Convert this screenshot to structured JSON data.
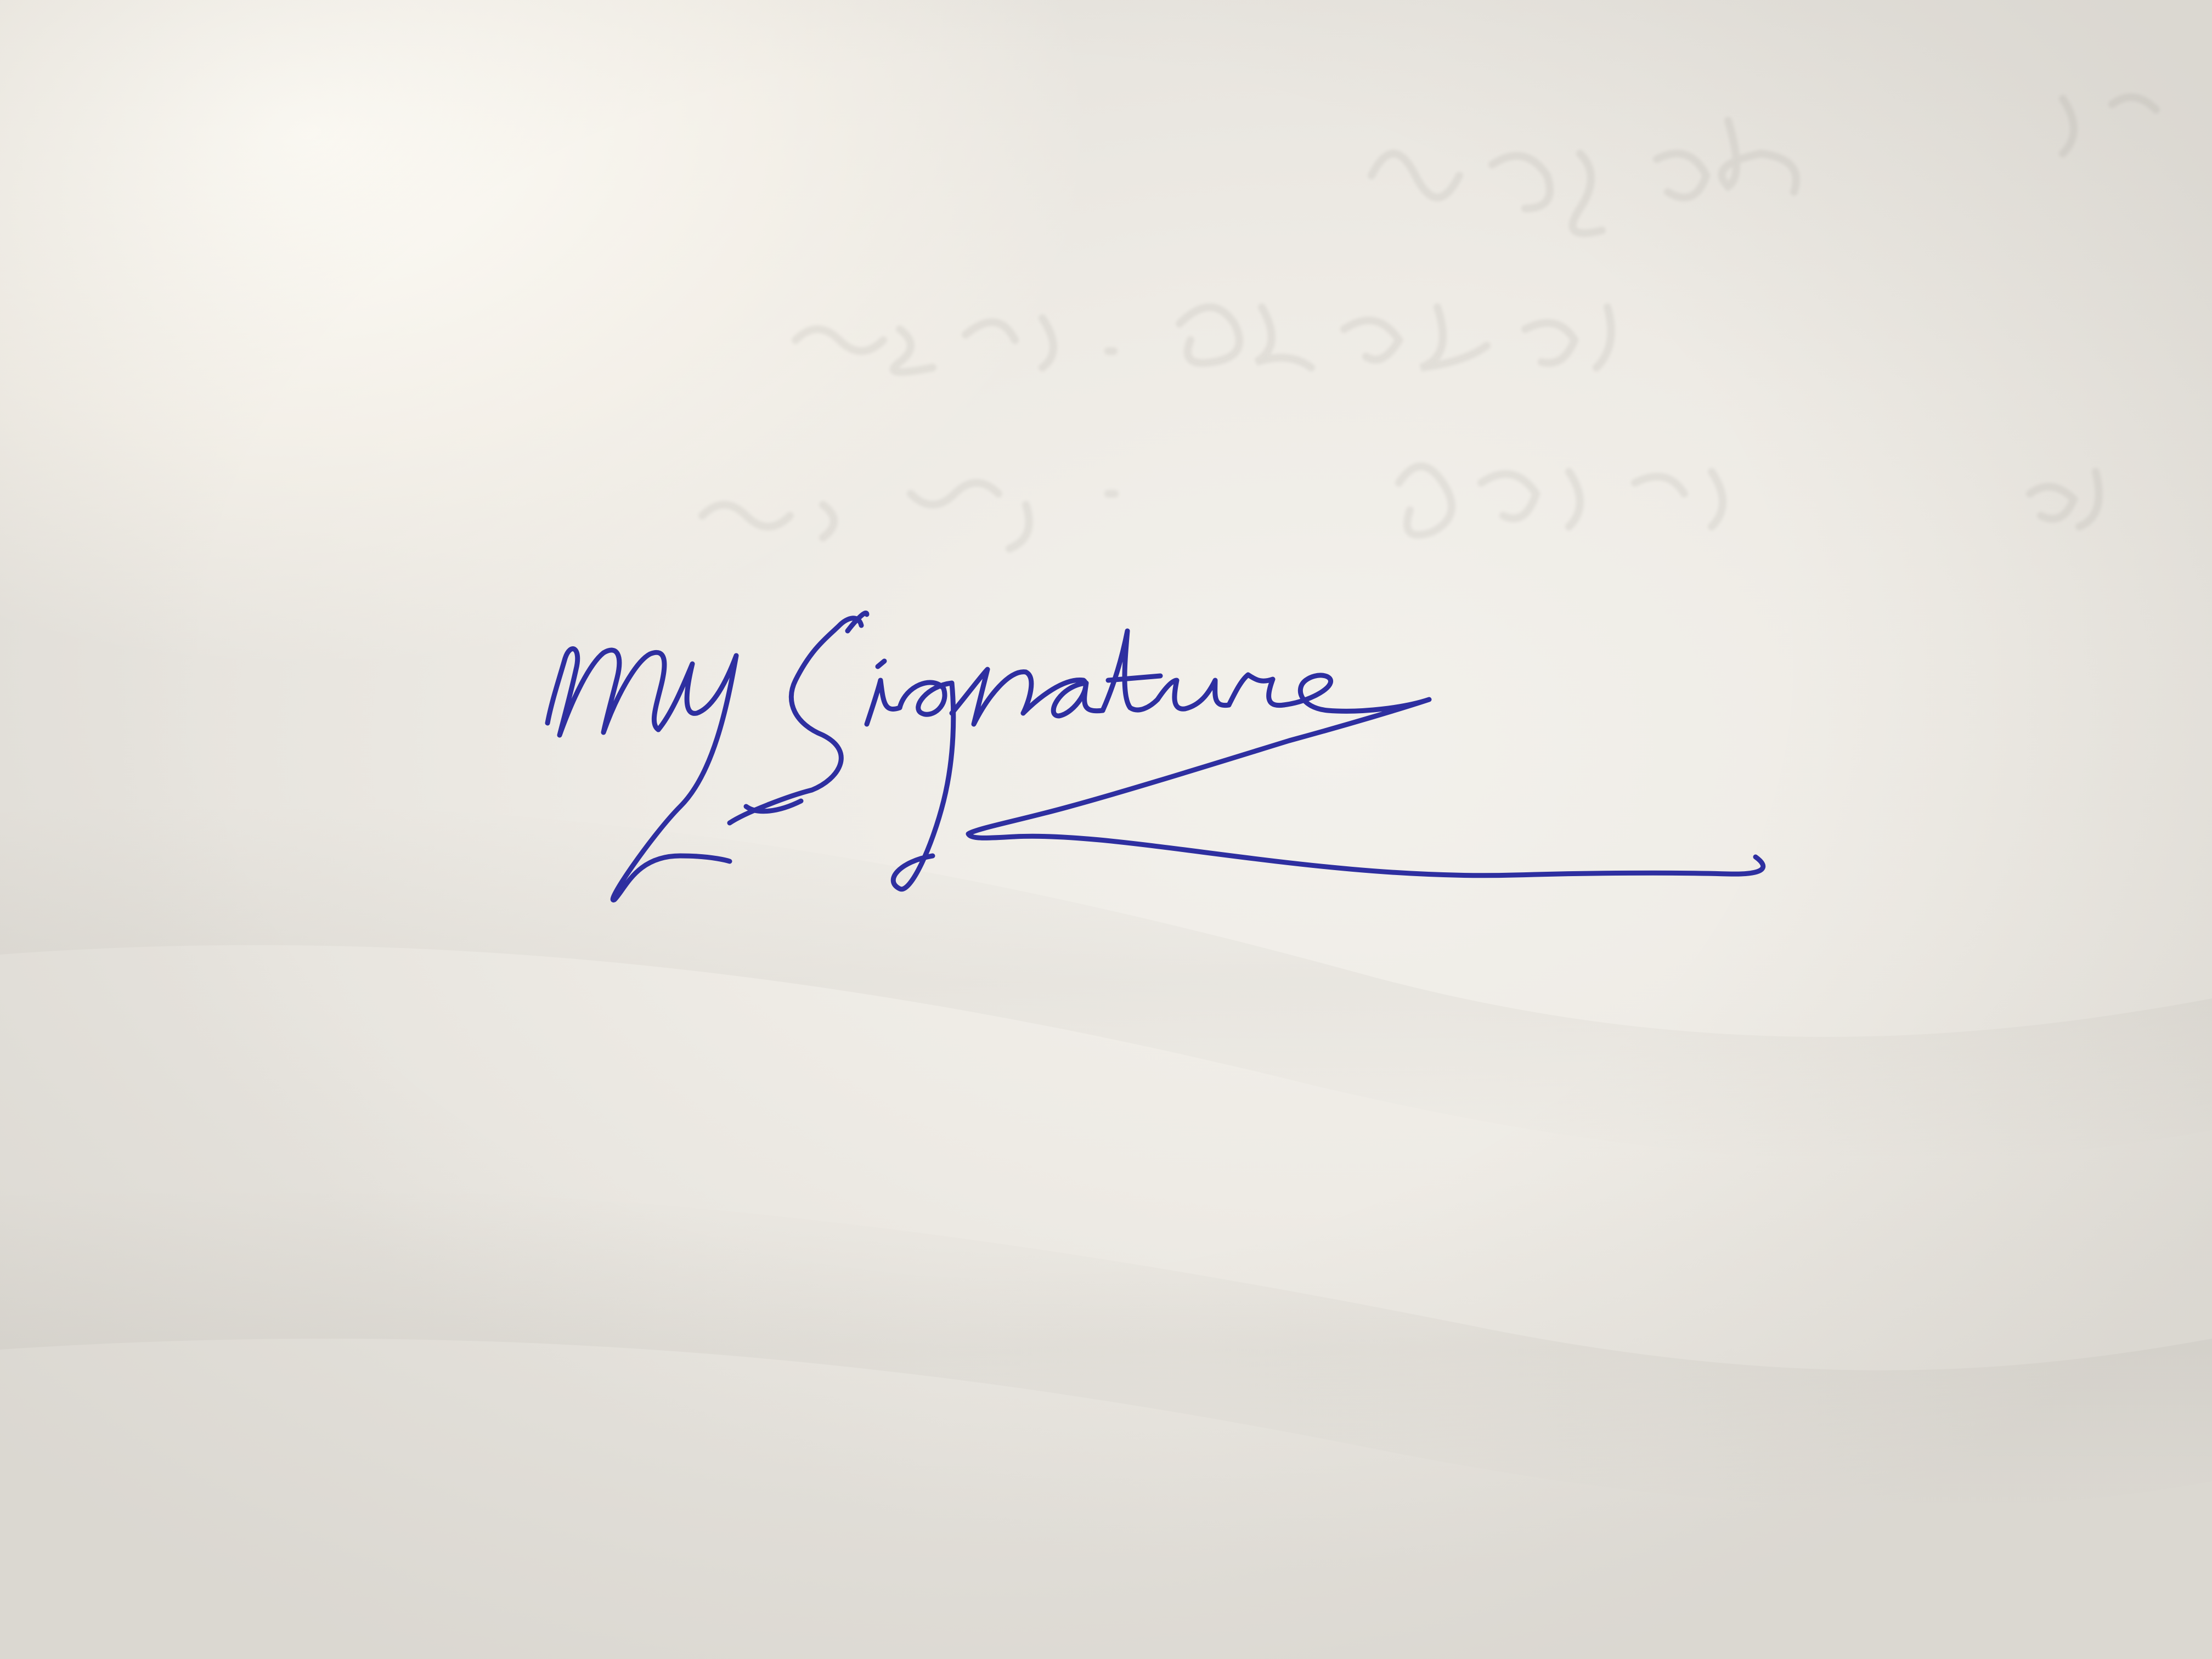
{
  "photo": {
    "paper_color": "#efece6",
    "ink_color": "#2e2fa0"
  },
  "signature": {
    "text": "mySignature",
    "style": "handwritten cursive with underline flourish"
  }
}
